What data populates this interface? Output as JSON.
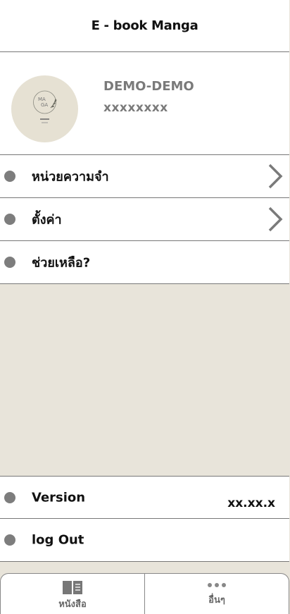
{
  "header": {
    "title": "E - book Manga"
  },
  "profile": {
    "name": "DEMO-DEMO",
    "id": "xxxxxxxx",
    "avatar": {
      "logo_text": "MA GA",
      "sub_text": "E-BOOK MANGA",
      "icon": "manga-logo"
    }
  },
  "menu": [
    {
      "label": "หน่วยความจำ",
      "chevron": true
    },
    {
      "label": "ตั้งค่า",
      "chevron": true
    },
    {
      "label": "ช่วยเหลือ?",
      "chevron": false
    }
  ],
  "footer_menu": {
    "version": {
      "label": "Version",
      "value": "xx.xx.x"
    },
    "logout": {
      "label": "log Out"
    }
  },
  "tabbar": [
    {
      "label": "หนังสือ",
      "icon": "book-icon"
    },
    {
      "label": "อื่นๆ",
      "icon": "more-dots-icon"
    }
  ],
  "colors": {
    "background": "#e8e4da",
    "dot": "#7d7d7d",
    "avatar": "#e6e1d3",
    "muted_text": "#7a7a7a"
  }
}
